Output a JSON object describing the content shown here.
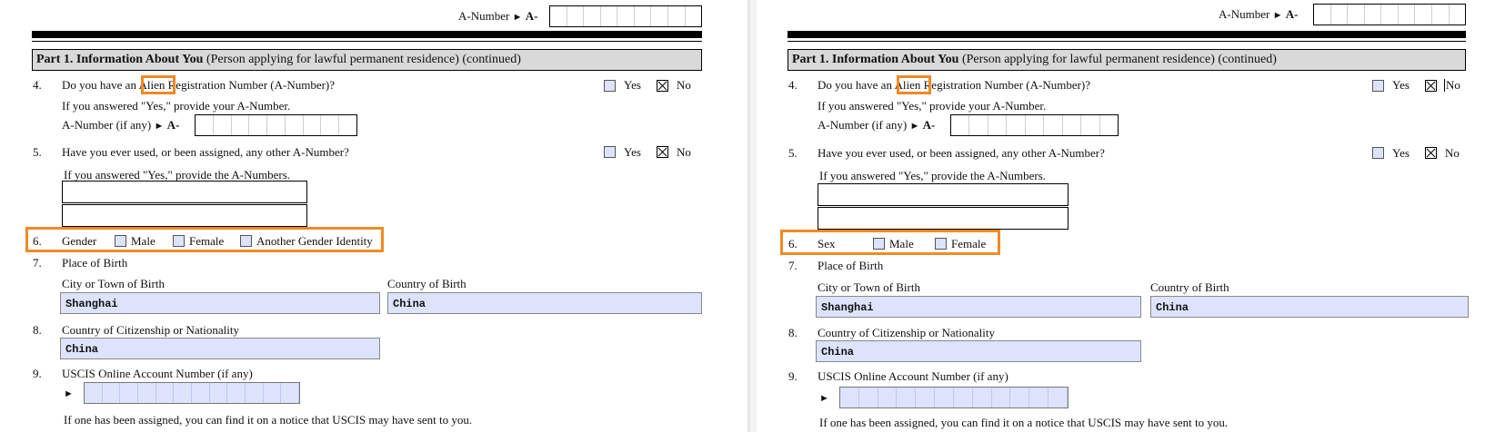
{
  "colors": {
    "highlight": "#f08a24",
    "field_fill": "#dde3fb",
    "part_bar": "#d9d9d9"
  },
  "left": {
    "a_number_header": {
      "label": "A-Number",
      "prefix": "A-"
    },
    "part_title": "Part 1. Information About You",
    "part_subtitle": "(Person applying for lawful permanent residence) (continued)",
    "q4": {
      "number": "4.",
      "text_before": "Do you have an ",
      "highlight_word": "Alien",
      "text_after": " Registration Number (A-Number)?",
      "yes": "Yes",
      "no": "No",
      "answer": "No",
      "hint": "If you answered \"Yes,\" provide your A-Number.",
      "field_label": "A-Number (if any)",
      "prefix": "A-"
    },
    "q5": {
      "number": "5.",
      "text": "Have you ever used, or been assigned, any other A-Number?",
      "yes": "Yes",
      "no": "No",
      "answer": "No",
      "hint": "If you answered \"Yes,\" provide the A-Numbers."
    },
    "q6": {
      "number": "6.",
      "label": "Gender",
      "options": [
        "Male",
        "Female",
        "Another Gender Identity"
      ]
    },
    "q7": {
      "number": "7.",
      "label": "Place of Birth",
      "city_label": "City or Town of Birth",
      "city_value": "Shanghai",
      "country_label": "Country of Birth",
      "country_value": "China"
    },
    "q8": {
      "number": "8.",
      "label": "Country of Citizenship or Nationality",
      "value": "China"
    },
    "q9": {
      "number": "9.",
      "label": "USCIS Online Account Number (if any)",
      "note": "If one has been assigned, you can find it on a notice that USCIS may have sent to you."
    }
  },
  "right": {
    "a_number_header": {
      "label": "A-Number",
      "prefix": "A-"
    },
    "part_title": "Part 1. Information About You",
    "part_subtitle": "(Person applying for lawful permanent residence) (continued)",
    "q4": {
      "number": "4.",
      "text_before": "Do you have an ",
      "highlight_word": "Alien",
      "text_after": " Registration Number (A-Number)?",
      "yes": "Yes",
      "no": "No",
      "answer": "No",
      "hint": "If you answered \"Yes,\" provide your A-Number.",
      "field_label": "A-Number (if any)",
      "prefix": "A-"
    },
    "q5": {
      "number": "5.",
      "text": "Have you ever used, or been assigned, any other A-Number?",
      "yes": "Yes",
      "no": "No",
      "answer": "No",
      "hint": "If you answered \"Yes,\" provide the A-Numbers."
    },
    "q6": {
      "number": "6.",
      "label": "Sex",
      "options": [
        "Male",
        "Female"
      ]
    },
    "q7": {
      "number": "7.",
      "label": "Place of Birth",
      "city_label": "City or Town of Birth",
      "city_value": "Shanghai",
      "country_label": "Country of Birth",
      "country_value": "China"
    },
    "q8": {
      "number": "8.",
      "label": "Country of Citizenship or Nationality",
      "value": "China"
    },
    "q9": {
      "number": "9.",
      "label": "USCIS Online Account Number (if any)",
      "note": "If one has been assigned, you can find it on a notice that USCIS may have sent to you."
    }
  }
}
